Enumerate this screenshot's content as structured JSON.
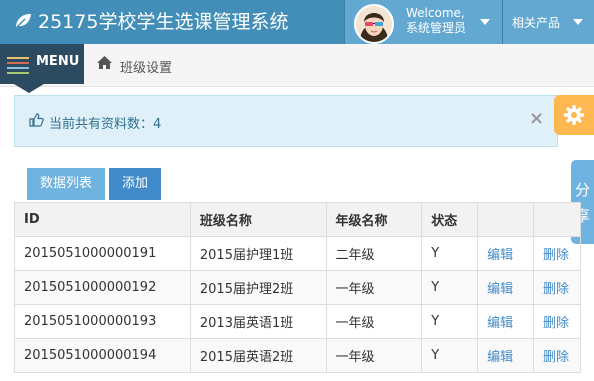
{
  "app": {
    "title": "25175学校学生选课管理系统",
    "welcome": "Welcome,",
    "user_name": "系统管理员",
    "related_products": "相关产品"
  },
  "menu": {
    "label": "MENU"
  },
  "breadcrumb": {
    "current": "班级设置"
  },
  "alert": {
    "text": "当前共有资料数：4",
    "close": "×"
  },
  "share": {
    "char1": "分",
    "char2": "享"
  },
  "tabs": {
    "list": "数据列表",
    "add": "添加"
  },
  "table": {
    "headers": [
      "ID",
      "班级名称",
      "年级名称",
      "状态",
      "",
      ""
    ],
    "rows": [
      {
        "id": "2015051000000191",
        "class": "2015届护理1班",
        "grade": "二年级",
        "status": "Y",
        "edit": "编辑",
        "delete": "删除"
      },
      {
        "id": "2015051000000192",
        "class": "2015届护理2班",
        "grade": "一年级",
        "status": "Y",
        "edit": "编辑",
        "delete": "删除"
      },
      {
        "id": "2015051000000193",
        "class": "2013届英语1班",
        "grade": "一年级",
        "status": "Y",
        "edit": "编辑",
        "delete": "删除"
      },
      {
        "id": "2015051000000194",
        "class": "2015届英语2班",
        "grade": "一年级",
        "status": "Y",
        "edit": "编辑",
        "delete": "删除"
      }
    ]
  },
  "icons": {
    "brand": "leaf-icon",
    "menu": "hamburger-icon",
    "home": "home-icon",
    "alert": "thumbs-up-icon",
    "settings": "gear-icon"
  },
  "colors": {
    "navbar": "#438eb9",
    "user_area": "#62a8d1",
    "menu_button": "#2c4b61",
    "alert_bg": "#dff0f8",
    "settings": "#ffb752",
    "tab_list": "#6fb3e0",
    "tab_add": "#428bca",
    "link": "#428bca"
  }
}
